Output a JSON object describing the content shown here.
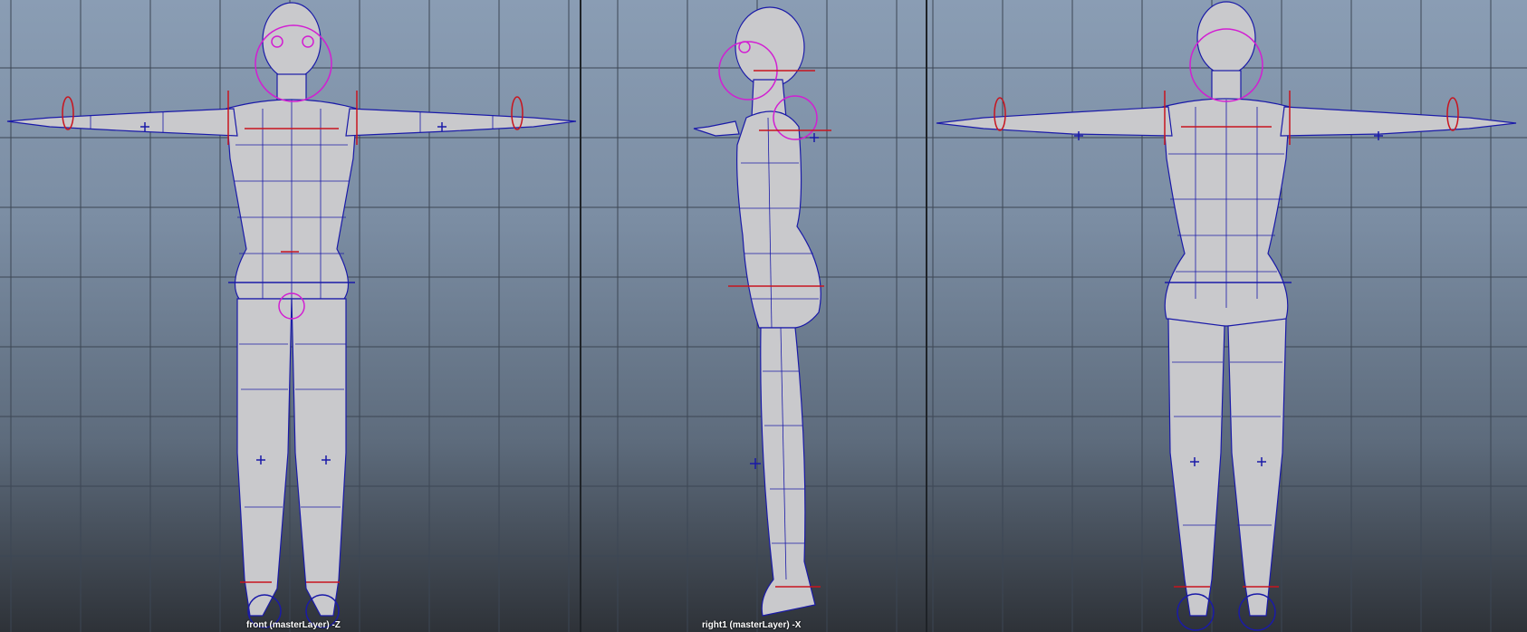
{
  "viewports": {
    "front": {
      "label": "front (masterLayer) -Z"
    },
    "side": {
      "label": "right1 (masterLayer) -X"
    },
    "back": {
      "label": ""
    }
  },
  "colors": {
    "grid": "#3c4654",
    "mesh_fill": "#c9c9cc",
    "wire": "#1a1aa8",
    "control_magenta": "#d21ed2",
    "control_red": "#c8141e"
  }
}
